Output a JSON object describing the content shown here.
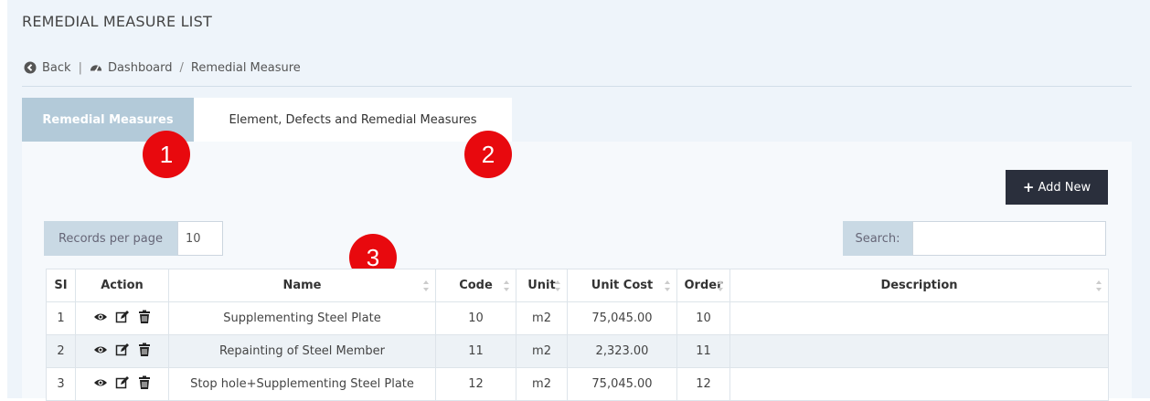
{
  "page": {
    "title": "REMEDIAL MEASURE LIST"
  },
  "breadcrumb": {
    "back": "Back",
    "separator1": "|",
    "dashboard": "Dashboard",
    "separator2": "/",
    "current": "Remedial Measure"
  },
  "tabs": [
    {
      "label": "Remedial Measures",
      "active": true
    },
    {
      "label": "Element, Defects and Remedial Measures",
      "active": false
    }
  ],
  "annotations": [
    "1",
    "2",
    "3"
  ],
  "toolbar": {
    "add_label": "Add New"
  },
  "records": {
    "label": "Records per page",
    "value": "10"
  },
  "search": {
    "label": "Search:",
    "value": ""
  },
  "table": {
    "columns": [
      "SI",
      "Action",
      "Name",
      "Code",
      "Unit",
      "Unit Cost",
      "Order",
      "Description"
    ],
    "rows": [
      {
        "si": "1",
        "name": "Supplementing Steel Plate",
        "code": "10",
        "unit": "m2",
        "cost": "75,045.00",
        "order": "10",
        "description": ""
      },
      {
        "si": "2",
        "name": "Repainting of Steel Member",
        "code": "11",
        "unit": "m2",
        "cost": "2,323.00",
        "order": "11",
        "description": ""
      },
      {
        "si": "3",
        "name": "Stop hole+Supplementing Steel Plate",
        "code": "12",
        "unit": "m2",
        "cost": "75,045.00",
        "order": "12",
        "description": ""
      }
    ]
  },
  "colors": {
    "active_tab": "#b3cad9",
    "badge": "#e8090e",
    "add_button": "#2a2f3c",
    "stripe": "#edf2f6"
  }
}
